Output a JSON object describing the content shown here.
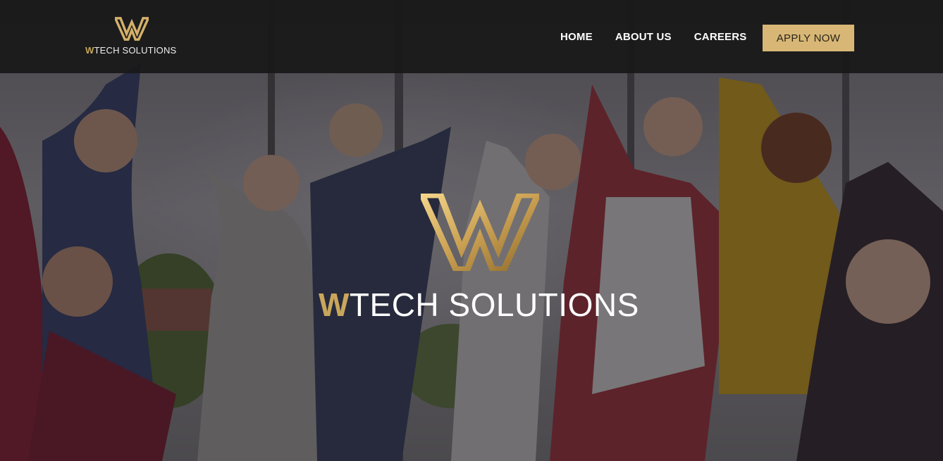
{
  "brand": {
    "logo_initial": "W",
    "logo_rest": "TECH SOLUTIONS",
    "logo_icon": "w-monogram-icon"
  },
  "nav": {
    "items": [
      {
        "label": "HOME"
      },
      {
        "label": "ABOUT US"
      },
      {
        "label": "CAREERS"
      }
    ],
    "cta_label": "APPLY NOW"
  },
  "hero": {
    "title_initial": "W",
    "title_rest": "TECH SOLUTIONS",
    "background": "photo of a group of cheering young people"
  },
  "colors": {
    "gold": "#c9a65c",
    "cta_background": "#d8b776",
    "header_background": "#181818"
  }
}
